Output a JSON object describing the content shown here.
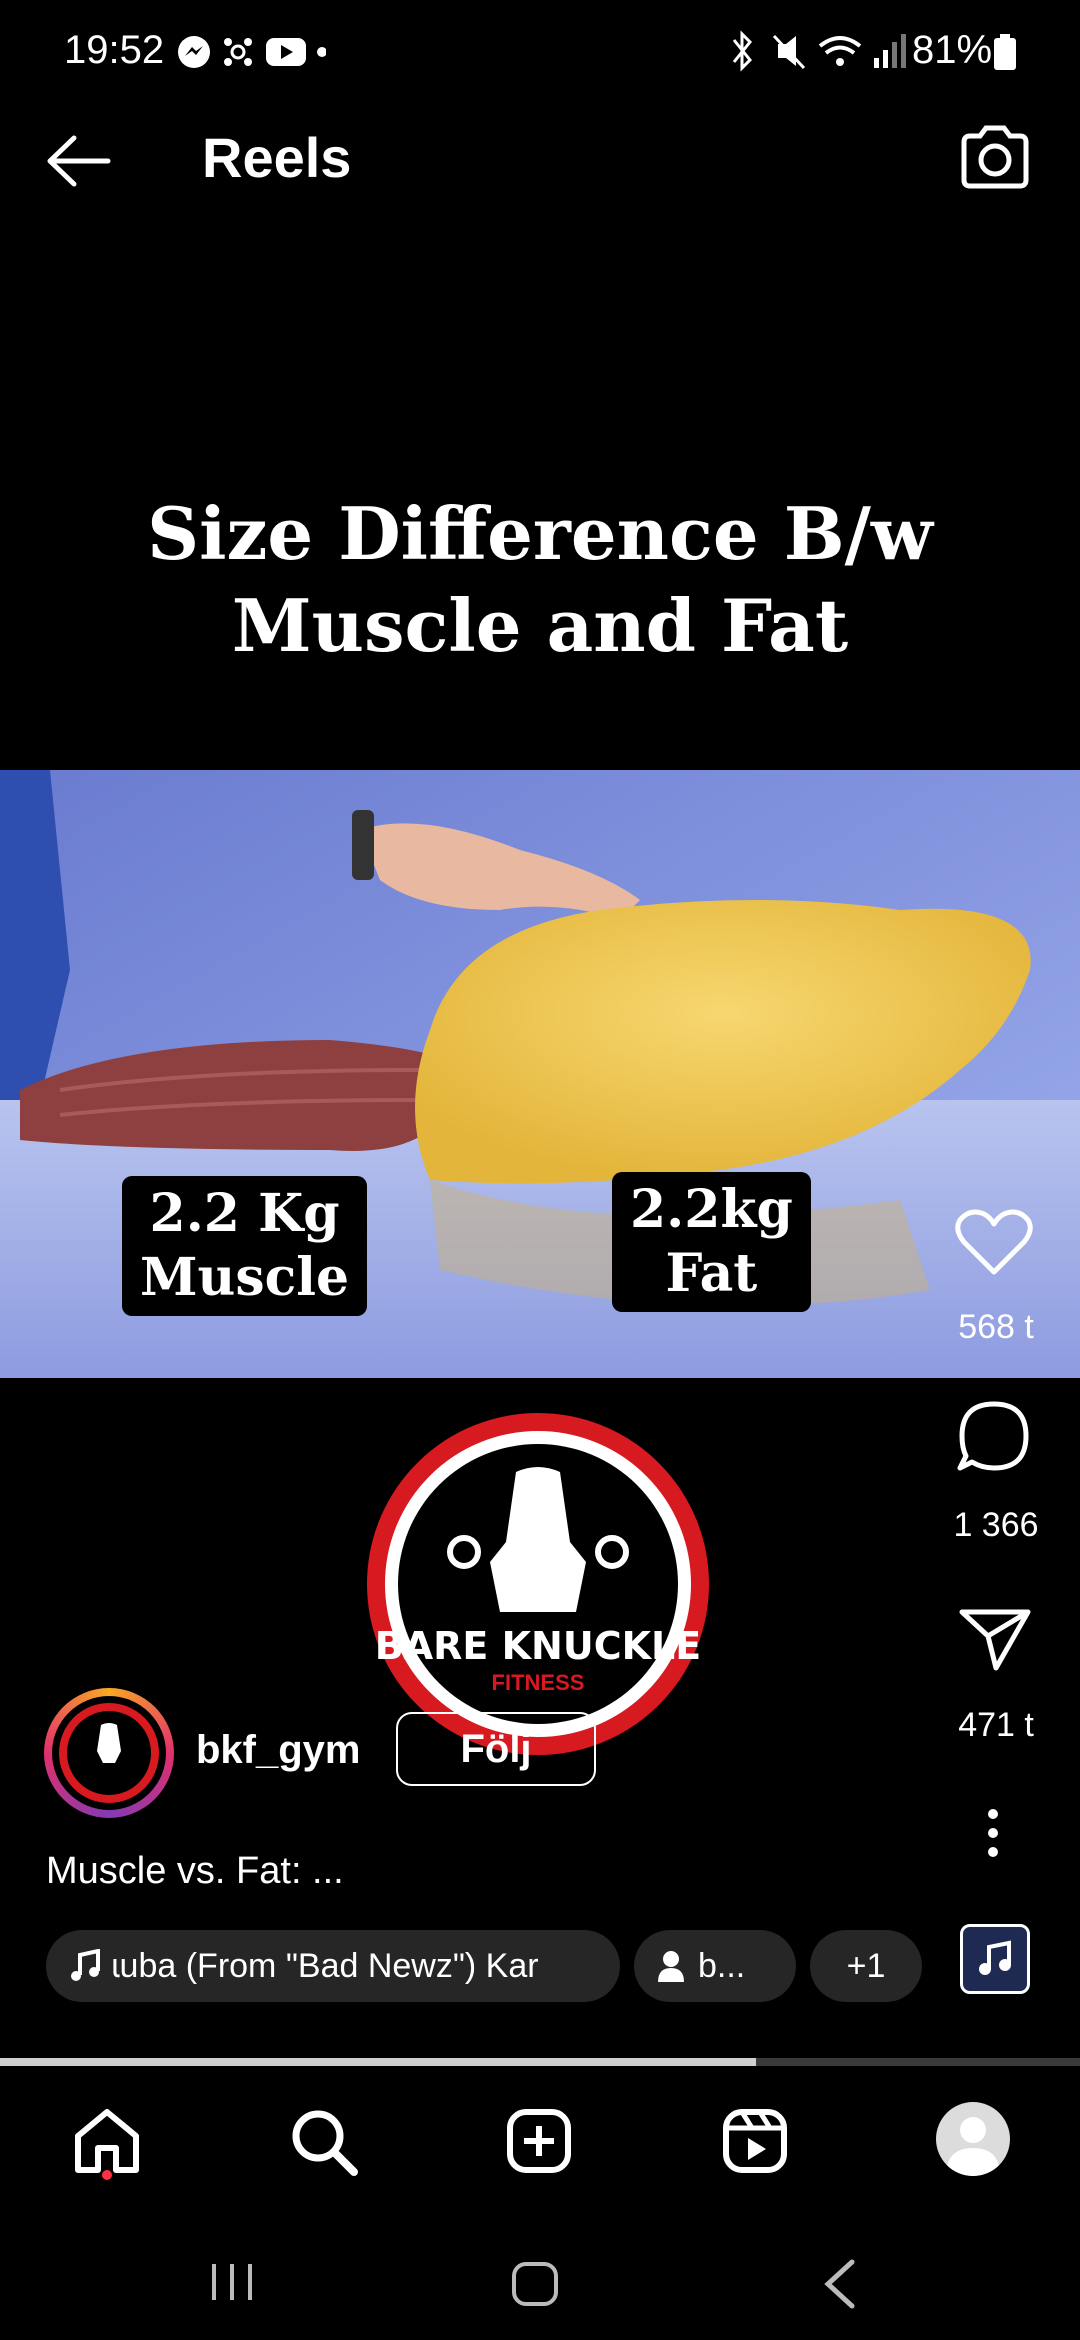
{
  "status_bar": {
    "time": "19:52",
    "battery": "81%"
  },
  "header": {
    "title": "Reels"
  },
  "video": {
    "title_line1": "Size Difference B/w",
    "title_line2": "Muscle and Fat",
    "label_left_line1": "2.2 Kg",
    "label_left_line2": "Muscle",
    "label_right_line1": "2.2kg",
    "label_right_line2": "Fat",
    "logo_text": "BARE KNUCKLE",
    "logo_sub": "FITNESS",
    "accent_red": "#d71920"
  },
  "actions": {
    "likes": "568 t",
    "comments": "1 366",
    "shares": "471 t"
  },
  "post": {
    "username": "bkf_gym",
    "follow_label": "Följ",
    "caption": "Muscle vs. Fat: ...",
    "music_pill": "ɩuba (From \"Bad Newz\")   Kar",
    "people_pill": "b...",
    "more_pill": "+1",
    "progress": 0.7
  }
}
